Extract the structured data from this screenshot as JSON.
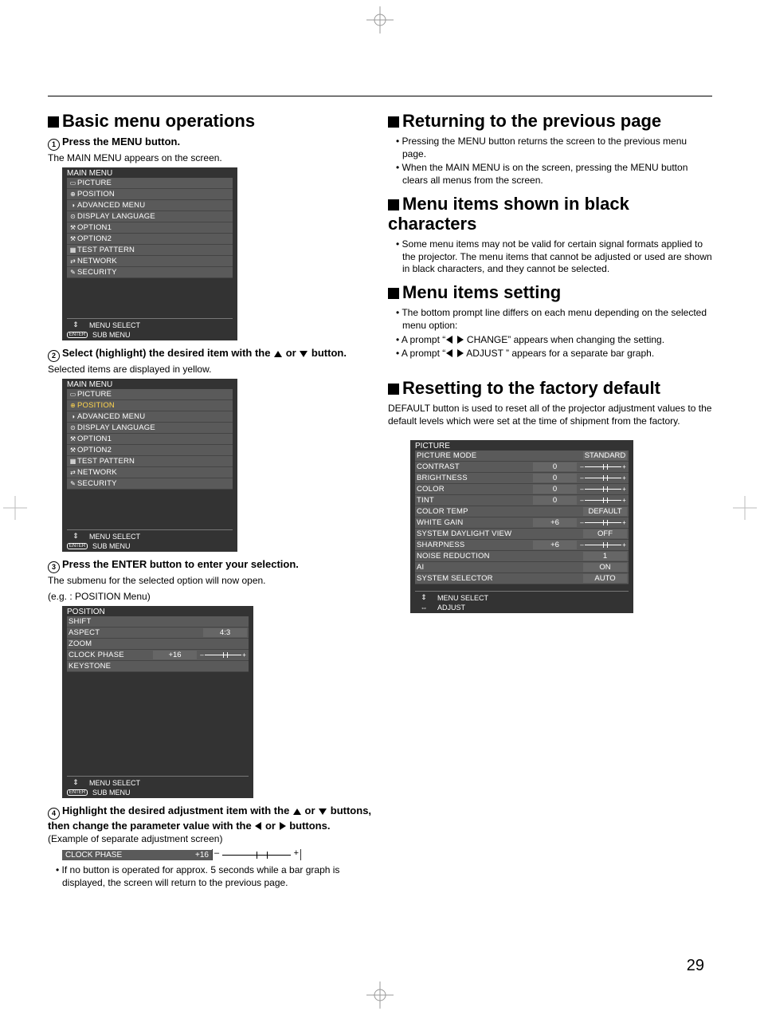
{
  "page_number": "29",
  "left": {
    "h1": "Basic menu operations",
    "step1": {
      "n": "1",
      "title": "Press the MENU button.",
      "body": "The MAIN MENU appears on the screen."
    },
    "osd1": {
      "title": "MAIN MENU",
      "items": [
        "PICTURE",
        "POSITION",
        "ADVANCED MENU",
        "DISPLAY LANGUAGE",
        "OPTION1",
        "OPTION2",
        "TEST PATTERN",
        "NETWORK",
        "SECURITY"
      ],
      "footer1": "MENU SELECT",
      "footer2": "SUB MENU"
    },
    "step2": {
      "n": "2",
      "title_pre": "Select (highlight) the desired item with the ",
      "title_mid": " or ",
      "title_post": " button.",
      "body": "Selected items are displayed in yellow."
    },
    "osd2": {
      "title": "MAIN MENU",
      "items": [
        "PICTURE",
        "POSITION",
        "ADVANCED MENU",
        "DISPLAY LANGUAGE",
        "OPTION1",
        "OPTION2",
        "TEST PATTERN",
        "NETWORK",
        "SECURITY"
      ],
      "selected_index": 1,
      "footer1": "MENU SELECT",
      "footer2": "SUB MENU"
    },
    "step3": {
      "n": "3",
      "title": "Press the ENTER button to enter your selection.",
      "body1": "The submenu for the selected option will now open.",
      "body2": "(e.g. : POSITION Menu)"
    },
    "osd3": {
      "title": "POSITION",
      "rows": [
        {
          "label": "SHIFT"
        },
        {
          "label": "ASPECT",
          "val": "4:3"
        },
        {
          "label": "ZOOM"
        },
        {
          "label": "CLOCK PHASE",
          "val": "+16",
          "bar": true
        },
        {
          "label": "KEYSTONE"
        }
      ],
      "footer1": "MENU SELECT",
      "footer2": "SUB MENU"
    },
    "step4": {
      "n": "4",
      "title_a": "Highlight the desired adjustment item with the ",
      "title_b": " or ",
      "title_c": " buttons, then change the parameter value with the ",
      "title_d": " or ",
      "title_e": " buttons.",
      "caption": "(Example of separate adjustment screen)",
      "adj_label": "CLOCK PHASE",
      "adj_val": "+16",
      "note": "If no button is operated for approx. 5 seconds while a bar graph is displayed, the screen will return to the previous page."
    }
  },
  "right": {
    "h1": "Returning to the previous page",
    "b1": "Pressing the MENU button returns the screen to the previous menu page.",
    "b2": "When the MAIN MENU is on the screen, pressing the MENU button clears all menus from the screen.",
    "h2": "Menu items shown in black characters",
    "b3": "Some menu items may not be valid for certain signal formats applied to the projector. The menu items that cannot be adjusted or used are shown in black characters, and they cannot be selected.",
    "h3": "Menu items setting",
    "b4": "The bottom prompt line differs on each menu depending on the selected menu option:",
    "b5_a": "A prompt “",
    "b5_b": " CHANGE” appears when changing the setting.",
    "b6_a": "A prompt “",
    "b6_b": " ADJUST  ” appears for a separate bar graph.",
    "h4": "Resetting to the factory default",
    "b7": "DEFAULT button is used to reset all of the projector adjustment values to the default levels which were set at the time of shipment from the factory.",
    "osd4": {
      "title": "PICTURE",
      "rows": [
        {
          "label": "PICTURE MODE",
          "val": "STANDARD"
        },
        {
          "label": "CONTRAST",
          "val": "0",
          "bar": true
        },
        {
          "label": "BRIGHTNESS",
          "val": "0",
          "bar": true
        },
        {
          "label": "COLOR",
          "val": "0",
          "bar": true
        },
        {
          "label": "TINT",
          "val": "0",
          "bar": true
        },
        {
          "label": "COLOR TEMP",
          "val": "DEFAULT"
        },
        {
          "label": "WHITE GAIN",
          "val": "+6",
          "bar": true
        },
        {
          "label": "SYSTEM DAYLIGHT VIEW",
          "val": "OFF"
        },
        {
          "label": "SHARPNESS",
          "val": "+6",
          "bar": true
        },
        {
          "label": "NOISE REDUCTION",
          "val": "1"
        },
        {
          "label": "AI",
          "val": "ON"
        },
        {
          "label": "SYSTEM SELECTOR",
          "val": "AUTO"
        }
      ],
      "footer1": "MENU SELECT",
      "footer2": "ADJUST"
    }
  }
}
